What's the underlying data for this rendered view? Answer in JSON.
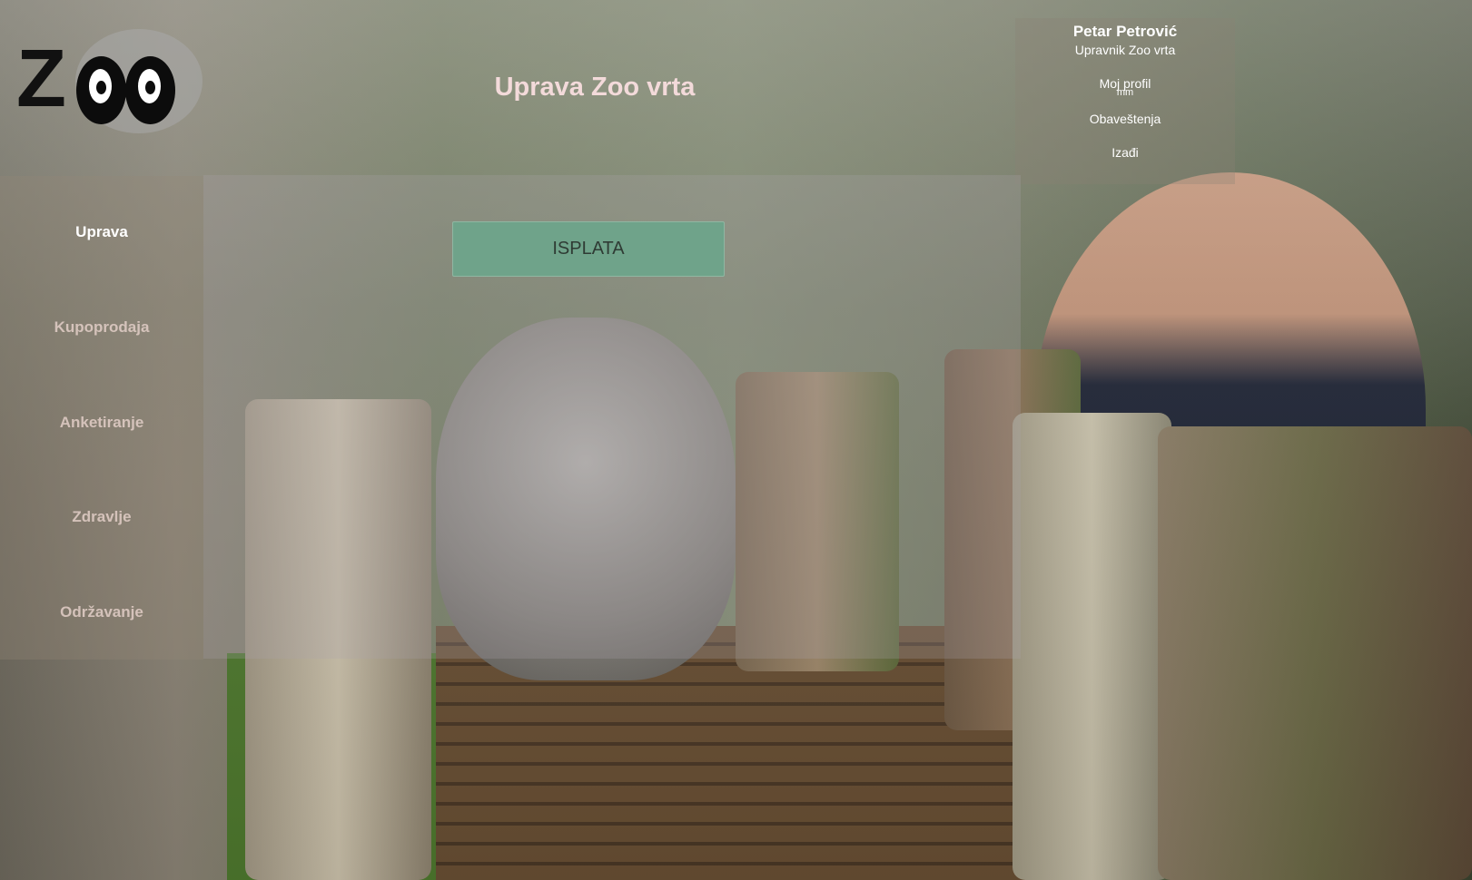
{
  "header": {
    "title": "Uprava Zoo vrta",
    "logo_text": "ZOO"
  },
  "user": {
    "name": "Petar Petrović",
    "role": "Upravnik Zoo vrta",
    "links": {
      "profile": "Moj profil",
      "profile_sub": "mm",
      "notifications": "Obaveštenja",
      "logout": "Izađi"
    }
  },
  "sidebar": {
    "items": [
      {
        "label": "Uprava",
        "active": true
      },
      {
        "label": "Kupoprodaja",
        "active": false
      },
      {
        "label": "Anketiranje",
        "active": false
      },
      {
        "label": "Zdravlje",
        "active": false
      },
      {
        "label": "Održavanje",
        "active": false
      }
    ]
  },
  "main": {
    "payout_button": "ISPLATA"
  },
  "colors": {
    "title": "#f3dada",
    "button_bg": "#6fa38a",
    "nav_active": "#ffffff",
    "nav_inactive": "#e3cfc8"
  }
}
